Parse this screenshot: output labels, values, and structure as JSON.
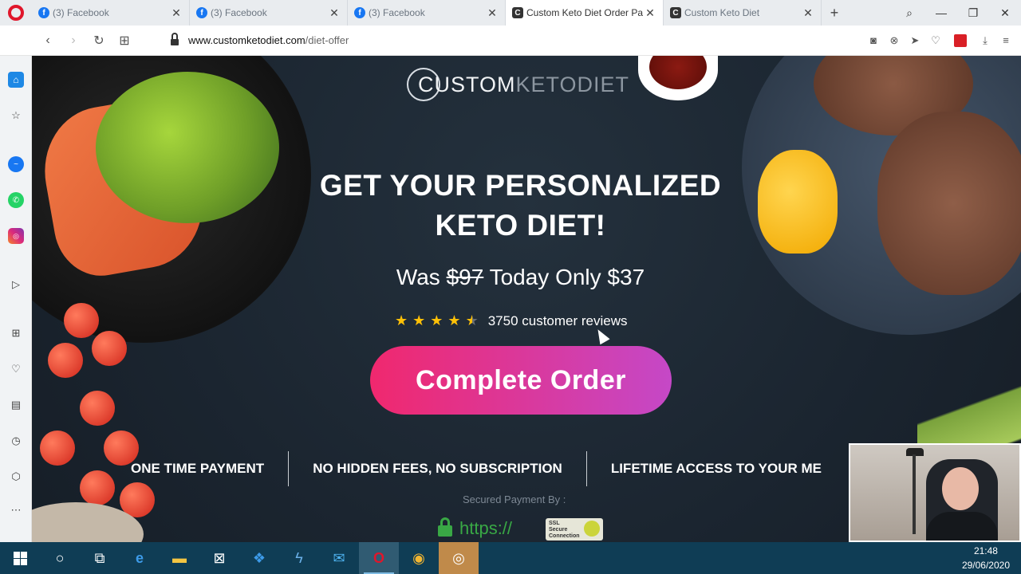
{
  "browser": {
    "tabs": [
      {
        "label": "(3) Facebook",
        "favicon": "facebook-icon",
        "active": false
      },
      {
        "label": "(3) Facebook",
        "favicon": "facebook-icon",
        "active": false
      },
      {
        "label": "(3) Facebook",
        "favicon": "facebook-icon",
        "active": false
      },
      {
        "label": "Custom Keto Diet Order Pa",
        "favicon": "customketo-icon",
        "active": true
      },
      {
        "label": "Custom Keto Diet",
        "favicon": "customketo-icon",
        "active": false
      }
    ],
    "url_host": "www.customketodiet.com",
    "url_path": "/diet-offer"
  },
  "page": {
    "logo_part1": "CUSTOM",
    "logo_part2": "KETODIET",
    "headline_line1": "GET YOUR PERSONALIZED",
    "headline_line2": "KETO DIET!",
    "price_prefix": "Was",
    "old_price": "$97",
    "price_suffix": "Today Only $37",
    "rating": 4.5,
    "reviews_text": "3750 customer reviews",
    "cta_label": "Complete Order",
    "features": [
      "ONE TIME PAYMENT",
      "NO HIDDEN FEES, NO SUBSCRIPTION",
      "LIFETIME ACCESS TO YOUR ME"
    ],
    "secured_label": "Secured Payment By :",
    "https_label": "https://",
    "ssl_badge_line1": "SSL",
    "ssl_badge_line2": "Secure",
    "ssl_badge_line3": "Connection"
  },
  "taskbar": {
    "time": "21:48",
    "date": "29/06/2020"
  },
  "colors": {
    "cta_start": "#f0286e",
    "cta_end": "#c548c7",
    "page_bg": "#1c2733",
    "star": "#ffc107",
    "secure_green": "#39a845"
  }
}
